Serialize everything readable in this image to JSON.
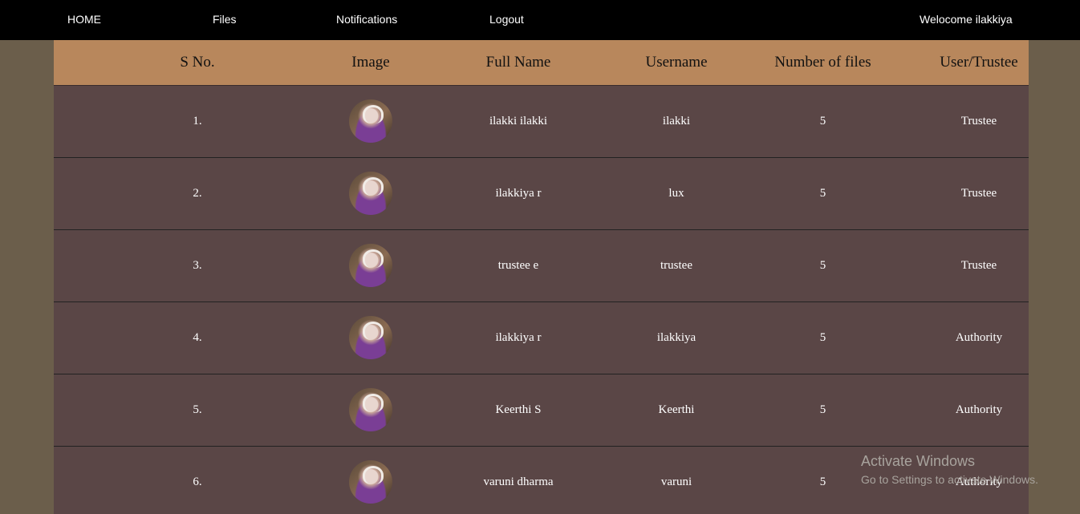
{
  "nav": {
    "home": "HOME",
    "files": "Files",
    "notifications": "Notifications",
    "logout": "Logout",
    "welcome": "Welocome ilakkiya"
  },
  "table": {
    "headers": [
      "S No.",
      "Image",
      "Full Name",
      "Username",
      "Number of files",
      "User/Trustee"
    ],
    "rows": [
      {
        "sno": "1.",
        "full_name": "ilakki ilakki",
        "username": "ilakki",
        "files": "5",
        "role": "Trustee"
      },
      {
        "sno": "2.",
        "full_name": "ilakkiya r",
        "username": "lux",
        "files": "5",
        "role": "Trustee"
      },
      {
        "sno": "3.",
        "full_name": "trustee e",
        "username": "trustee",
        "files": "5",
        "role": "Trustee"
      },
      {
        "sno": "4.",
        "full_name": "ilakkiya r",
        "username": "ilakkiya",
        "files": "5",
        "role": "Authority"
      },
      {
        "sno": "5.",
        "full_name": "Keerthi S",
        "username": "Keerthi",
        "files": "5",
        "role": "Authority"
      },
      {
        "sno": "6.",
        "full_name": "varuni dharma",
        "username": "varuni",
        "files": "5",
        "role": "Authority"
      }
    ]
  },
  "watermark": {
    "title": "Activate Windows",
    "subtitle": "Go to Settings to activate Windows."
  },
  "colors": {
    "nav_bg": "#000000",
    "page_bg": "#6b5e4b",
    "header_bg": "#b8875c",
    "row_bg": "#5a4646"
  }
}
